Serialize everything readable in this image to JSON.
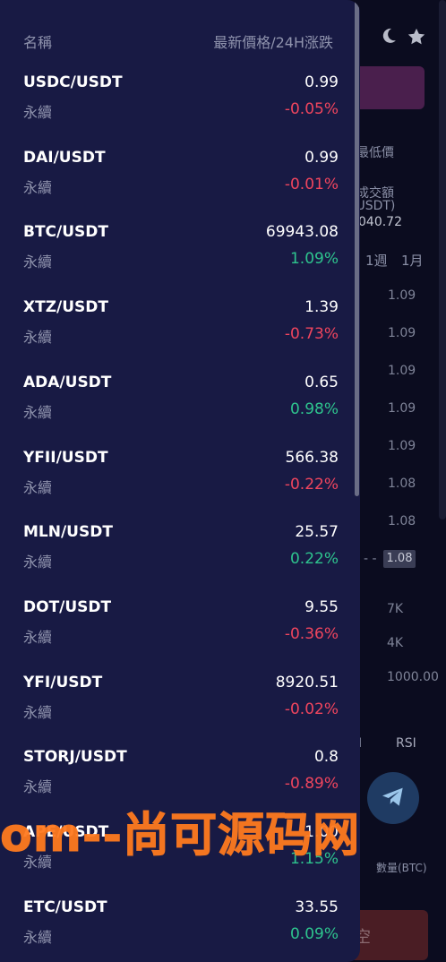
{
  "header": {
    "name_label": "名稱",
    "price_label": "最新價格/24H涨跌"
  },
  "pairs": [
    {
      "symbol": "USDC/USDT",
      "price": "0.99",
      "type": "永續",
      "change": "-0.05%",
      "dir": "down"
    },
    {
      "symbol": "DAI/USDT",
      "price": "0.99",
      "type": "永續",
      "change": "-0.01%",
      "dir": "down"
    },
    {
      "symbol": "BTC/USDT",
      "price": "69943.08",
      "type": "永續",
      "change": "1.09%",
      "dir": "up"
    },
    {
      "symbol": "XTZ/USDT",
      "price": "1.39",
      "type": "永續",
      "change": "-0.73%",
      "dir": "down"
    },
    {
      "symbol": "ADA/USDT",
      "price": "0.65",
      "type": "永續",
      "change": "0.98%",
      "dir": "up"
    },
    {
      "symbol": "YFII/USDT",
      "price": "566.38",
      "type": "永續",
      "change": "-0.22%",
      "dir": "down"
    },
    {
      "symbol": "MLN/USDT",
      "price": "25.57",
      "type": "永續",
      "change": "0.22%",
      "dir": "up"
    },
    {
      "symbol": "DOT/USDT",
      "price": "9.55",
      "type": "永續",
      "change": "-0.36%",
      "dir": "down"
    },
    {
      "symbol": "YFI/USDT",
      "price": "8920.51",
      "type": "永續",
      "change": "-0.02%",
      "dir": "down"
    },
    {
      "symbol": "STORJ/USDT",
      "price": "0.8",
      "type": "永續",
      "change": "-0.89%",
      "dir": "down"
    },
    {
      "symbol": "APE/USDT",
      "price": "1.00",
      "type": "永續",
      "change": "1.15%",
      "dir": "up"
    },
    {
      "symbol": "ETC/USDT",
      "price": "33.55",
      "type": "永續",
      "change": "0.09%",
      "dir": "up"
    }
  ],
  "background": {
    "low_label": "最低價",
    "volume_label": "成交額",
    "volume_unit": "(USDT)",
    "volume_value": "040.72",
    "tab_week": "1週",
    "tab_month": "1月",
    "ladder": [
      "1.09",
      "1.09",
      "1.09",
      "1.09",
      "1.09",
      "1.08",
      "1.08"
    ],
    "current_price": "1.08",
    "dash": "- -",
    "depth_7k": "7K",
    "depth_4k": "4K",
    "depth_1000": "1000.00",
    "rsi_label": "RSI",
    "rsi_prefix": "I",
    "qty_label": "數量(BTC)",
    "short_btn": "空"
  },
  "watermark": "om--尚可源码网",
  "colors": {
    "drawer_bg": "#181a44",
    "up": "#2ec48e",
    "down": "#f0455e",
    "muted": "#8f93ad"
  }
}
